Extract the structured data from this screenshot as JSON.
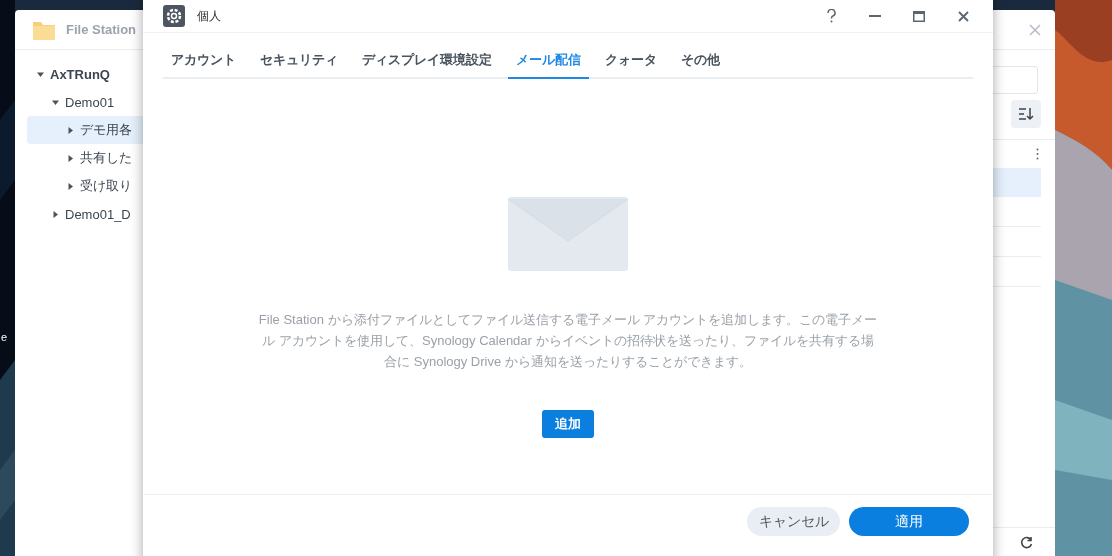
{
  "desktop": {
    "icon_label": "e"
  },
  "file_station": {
    "title": "File Station",
    "tree": [
      {
        "label": "AxTRunQ",
        "expanded": true,
        "selected": false,
        "children": [
          {
            "label": "Demo01",
            "expanded": true,
            "selected": false,
            "children": [
              {
                "label": "デモ用各",
                "expanded": false,
                "selected": true
              },
              {
                "label": "共有した",
                "expanded": false,
                "selected": false
              },
              {
                "label": "受け取り",
                "expanded": false,
                "selected": false
              }
            ]
          },
          {
            "label": "Demo01_D",
            "expanded": false,
            "selected": false
          }
        ]
      }
    ]
  },
  "dialog": {
    "title": "個人",
    "tabs": [
      {
        "label": "アカウント",
        "selected": false
      },
      {
        "label": "セキュリティ",
        "selected": false
      },
      {
        "label": "ディスプレイ環境設定",
        "selected": false
      },
      {
        "label": "メール配信",
        "selected": true
      },
      {
        "label": "クォータ",
        "selected": false
      },
      {
        "label": "その他",
        "selected": false
      }
    ],
    "message": "File Station から添付ファイルとしてファイル送信する電子メール アカウントを追加します。この電子メール アカウントを使用して、Synology Calendar からイベントの招待状を送ったり、ファイルを共有する場合に Synology Drive から通知を送ったりすることができます。",
    "add_button": "追加",
    "buttons": [
      {
        "label": "キャンセル",
        "kind": "secondary"
      },
      {
        "label": "適用",
        "kind": "primary"
      }
    ]
  }
}
